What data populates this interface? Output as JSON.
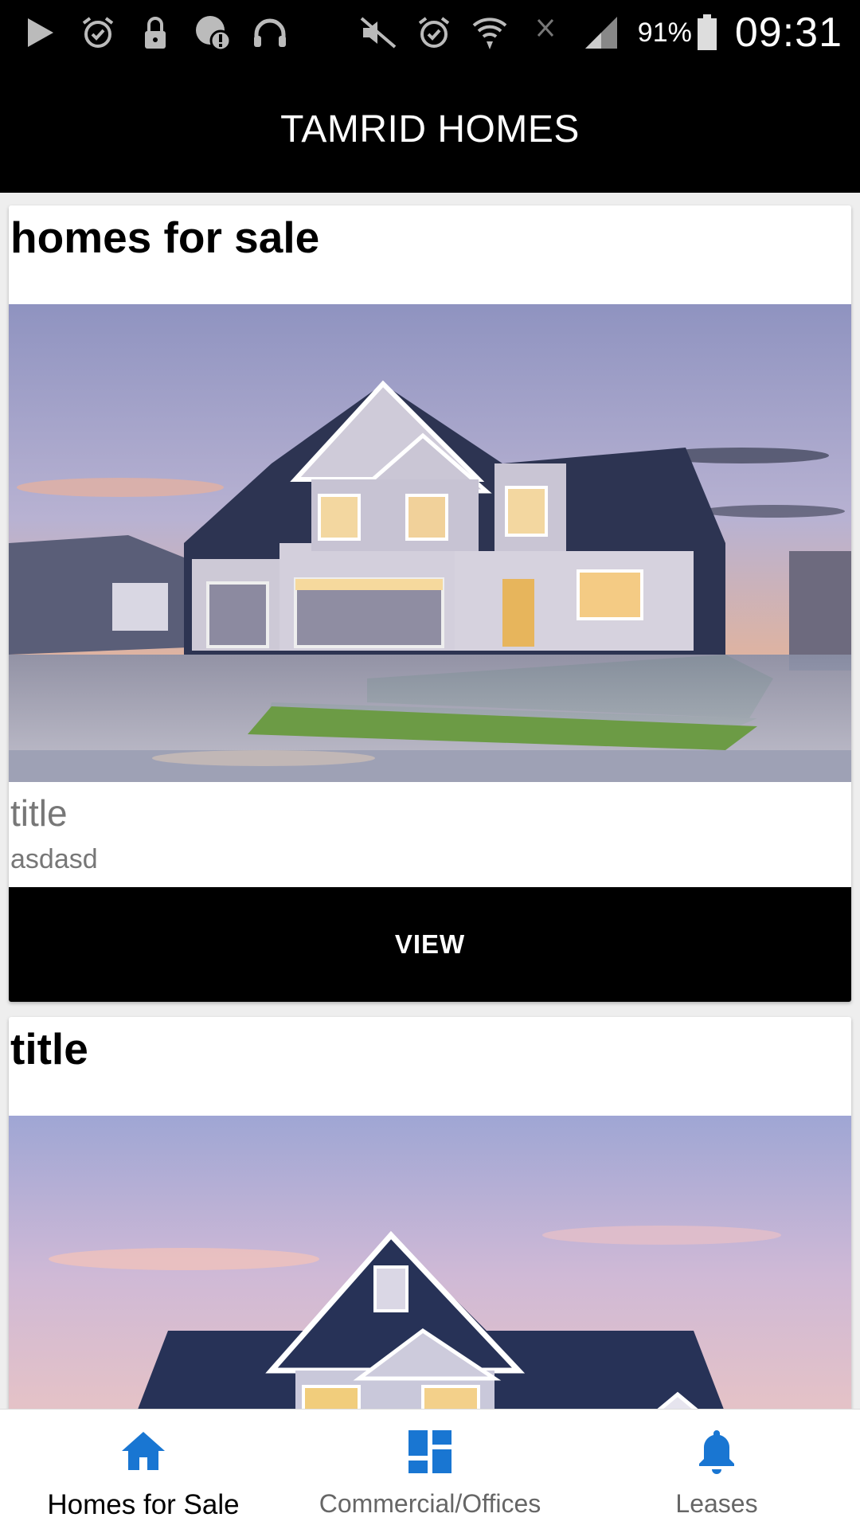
{
  "status_bar": {
    "battery": "91%",
    "time": "09:31",
    "icons_left": [
      "play-icon",
      "alarm-icon",
      "lock-icon",
      "alert-icon",
      "headphones-icon"
    ],
    "icons_right": [
      "mute-icon",
      "alarm-icon",
      "wifi-icon",
      "no-signal-icon",
      "signal-icon",
      "battery-icon"
    ]
  },
  "app_bar": {
    "title": "TAMRID HOMES"
  },
  "cards": [
    {
      "heading": "homes for sale",
      "title": "title",
      "description": "asdasd",
      "button": "VIEW"
    },
    {
      "heading": "title"
    }
  ],
  "bottom_nav": {
    "items": [
      {
        "label": "Homes for Sale",
        "icon": "home-icon",
        "active": true
      },
      {
        "label": "Commercial/Offices",
        "icon": "dashboard-icon",
        "active": false
      },
      {
        "label": "Leases",
        "icon": "bell-icon",
        "active": false
      }
    ]
  },
  "colors": {
    "accent": "#1976d2",
    "app_bar": "#000000",
    "button": "#000000"
  }
}
